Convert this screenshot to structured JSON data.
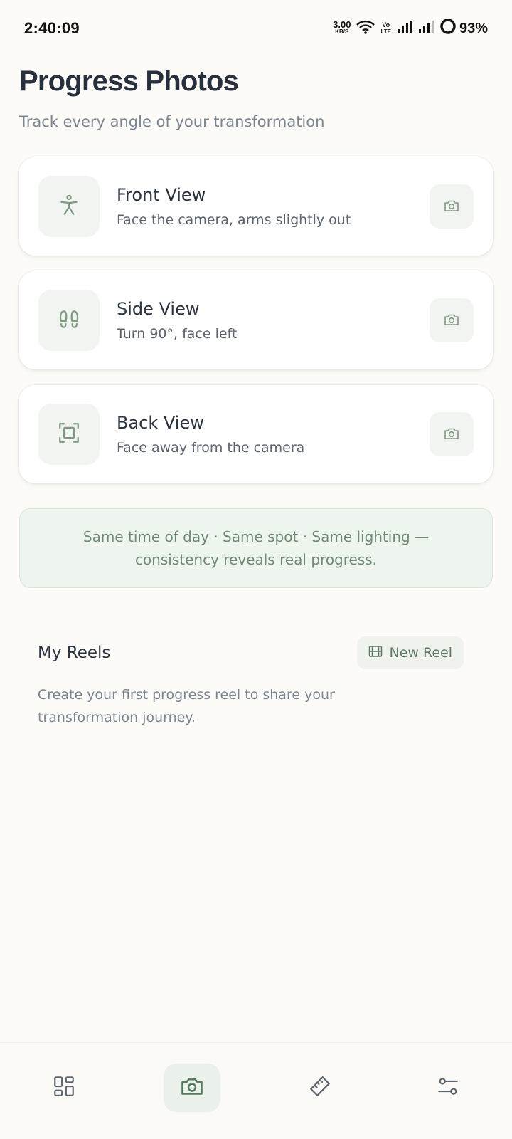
{
  "status_bar": {
    "time": "2:40:09",
    "net_speed_value": "3.00",
    "net_speed_unit": "KB/S",
    "volte_top": "Vo",
    "volte_bottom": "LTE",
    "battery": "93%"
  },
  "header": {
    "title": "Progress Photos",
    "subtitle": "Track every angle of your transformation"
  },
  "views": [
    {
      "title": "Front View",
      "description": "Face the camera, arms slightly out",
      "icon": "person-standing-icon"
    },
    {
      "title": "Side View",
      "description": "Turn 90°, face left",
      "icon": "footprints-icon"
    },
    {
      "title": "Back View",
      "description": "Face away from the camera",
      "icon": "scan-frame-icon"
    }
  ],
  "tip": {
    "line1": "Same time of day · Same spot · Same lighting —",
    "line2": "consistency reveals real progress."
  },
  "reels": {
    "title": "My Reels",
    "new_button_label": "New Reel",
    "empty_text": "Create your first progress reel to share your transformation journey."
  },
  "bottom_nav": {
    "items": [
      "dashboard-icon",
      "camera-icon",
      "ruler-icon",
      "settings-sliders-icon"
    ],
    "active_index": 1
  },
  "colors": {
    "background": "#fcfbf7",
    "accent_green": "#6e8a73",
    "icon_green": "#7f9a84",
    "title_dark": "#28303d",
    "muted_text": "#7c8593"
  }
}
